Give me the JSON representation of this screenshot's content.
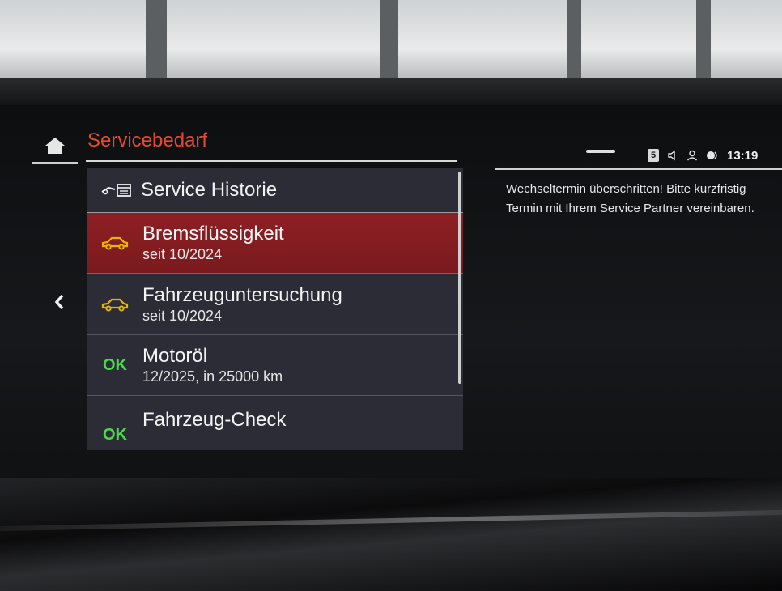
{
  "header": {
    "title": "Servicebedarf",
    "home_icon": "home-icon"
  },
  "status_bar": {
    "badge": "5",
    "time": "13:19",
    "icons": [
      "volume-icon",
      "profile-icon",
      "connectivity-icon"
    ]
  },
  "panel": {
    "header_label": "Service Historie",
    "header_icon": "service-history-icon",
    "items": [
      {
        "title": "Bremsflüssigkeit",
        "subtitle": "seit 10/2024",
        "status_icon": "car-warning-icon",
        "status_color": "#e8b400",
        "selected": true
      },
      {
        "title": "Fahrzeuguntersuchung",
        "subtitle": "seit 10/2024",
        "status_icon": "car-warning-icon",
        "status_color": "#e8b400",
        "selected": false
      },
      {
        "title": "Motoröl",
        "subtitle": "12/2025, in 25000 km",
        "status_label": "OK",
        "status_color": "#4cd94c",
        "selected": false
      },
      {
        "title": "Fahrzeug-Check",
        "subtitle": "",
        "status_label": "OK",
        "status_color": "#4cd94c",
        "selected": false
      }
    ]
  },
  "detail": {
    "message": "Wechseltermin überschritten! Bitte kurzfristig Termin mit Ihrem Service Partner vereinbaren."
  },
  "colors": {
    "accent": "#e64a2e",
    "selected_row": "#8d1f24",
    "panel_bg": "#2b2c35"
  }
}
